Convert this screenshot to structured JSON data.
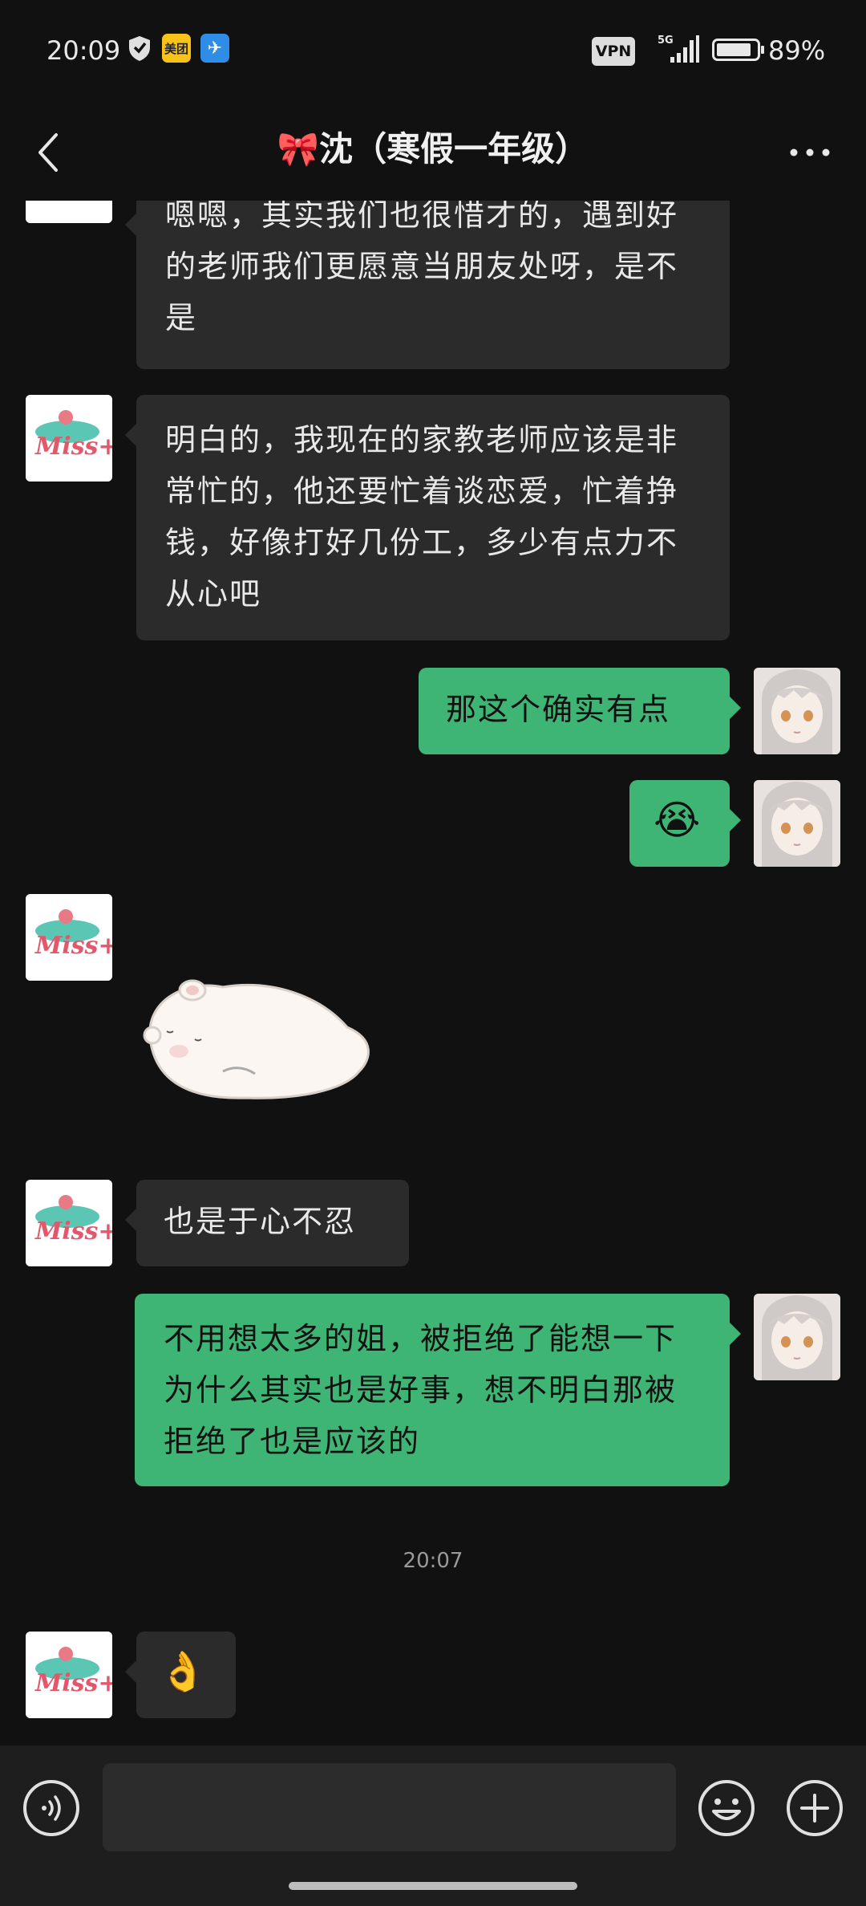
{
  "status_bar": {
    "time": "20:09",
    "app_badge_meituan": "美团",
    "vpn": "VPN",
    "network": "5G",
    "battery": "89%",
    "battery_level": 0.89
  },
  "header": {
    "title": "🎀沈（寒假一年级）"
  },
  "messages": [
    {
      "side": "in",
      "text": "嗯嗯，其实我们也很惜才的，遇到好的老师我们更愿意当朋友处呀，是不是"
    },
    {
      "side": "in",
      "text": "明白的，我现在的家教老师应该是非常忙的，他还要忙着谈恋爱，忙着挣钱，好像打好几份工，多少有点力不从心吧"
    },
    {
      "side": "out",
      "text": "那这个确实有点"
    },
    {
      "side": "out",
      "text": "😭"
    },
    {
      "side": "in",
      "sticker": "hamster-lying-sticker"
    },
    {
      "side": "in",
      "text": "也是于心不忍"
    },
    {
      "side": "out",
      "text": "不用想太多的姐，被拒绝了能想一下为什么其实也是好事，想不明白那被拒绝了也是应该的"
    },
    {
      "side": "time",
      "text": "20:07"
    },
    {
      "side": "in",
      "text": "👌"
    }
  ],
  "avatars": {
    "left_logo_text": "Miss+"
  },
  "input": {
    "placeholder": ""
  }
}
